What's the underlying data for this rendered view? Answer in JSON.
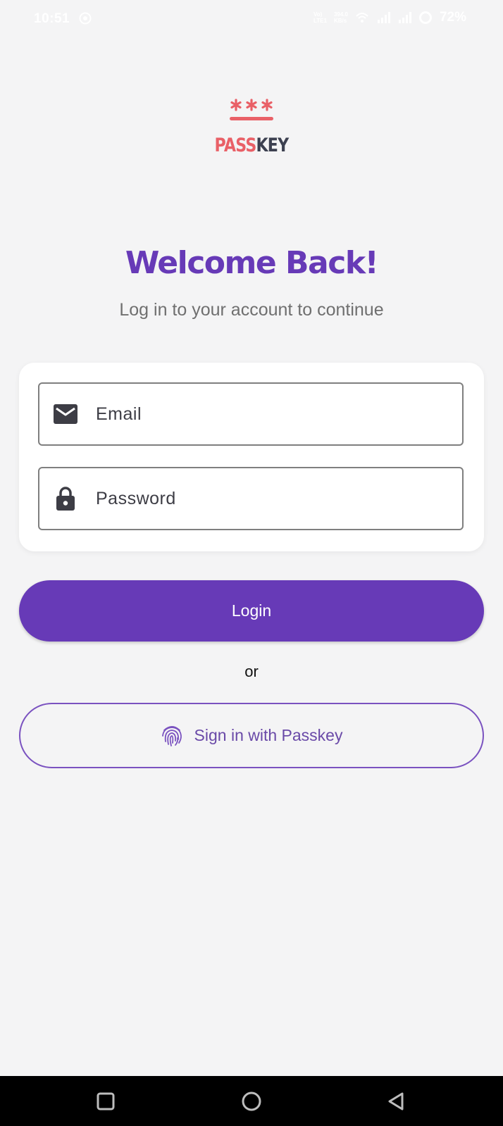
{
  "status_bar": {
    "time": "10:51",
    "network_top": "Vo)",
    "network_bottom": "LTE1",
    "speed_top": "394.0",
    "speed_bottom": "KB/s",
    "battery": "72%"
  },
  "logo": {
    "stars": "***",
    "word_part1": "PASS",
    "word_part2": "KEY"
  },
  "header": {
    "title": "Welcome Back!",
    "subtitle": "Log in to your account to continue"
  },
  "form": {
    "email_placeholder": "Email",
    "email_value": "",
    "password_placeholder": "Password",
    "password_value": ""
  },
  "actions": {
    "login_label": "Login",
    "separator": "or",
    "passkey_label": "Sign in with Passkey"
  },
  "icons": {
    "email": "mail-icon",
    "password": "lock-icon",
    "passkey": "fingerprint-icon",
    "nav_recents": "square-icon",
    "nav_home": "circle-icon",
    "nav_back": "triangle-back-icon"
  },
  "colors": {
    "primary": "#673ab7",
    "logo_red": "#e96067",
    "logo_dark": "#3c4050",
    "background": "#f4f4f5"
  }
}
